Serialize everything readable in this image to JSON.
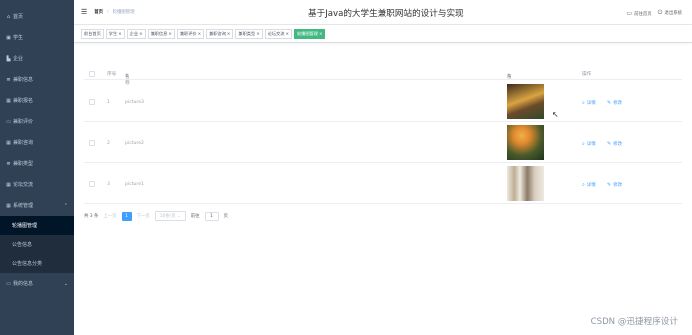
{
  "sidebar": {
    "items": [
      {
        "label": "首页",
        "icon": "home-icon"
      },
      {
        "label": "学生",
        "icon": "user-icon"
      },
      {
        "label": "企业",
        "icon": "building-icon"
      },
      {
        "label": "兼职信息",
        "icon": "list-icon"
      },
      {
        "label": "兼职报名",
        "icon": "grid-icon"
      },
      {
        "label": "兼职评价",
        "icon": "monitor-icon"
      },
      {
        "label": "兼职咨询",
        "icon": "grid-icon"
      },
      {
        "label": "兼职类型",
        "icon": "list-icon"
      },
      {
        "label": "论坛交流",
        "icon": "grid-icon"
      },
      {
        "label": "系统管理",
        "icon": "grid-icon",
        "expanded": true
      }
    ],
    "sub_items": [
      {
        "label": "轮播图管理",
        "active": true
      },
      {
        "label": "公告信息",
        "active": false
      },
      {
        "label": "公告信息分类",
        "active": false
      }
    ],
    "last_item": {
      "label": "我的信息",
      "icon": "monitor-icon"
    }
  },
  "header": {
    "breadcrumb_home": "首页",
    "breadcrumb_current": "轮播图管理",
    "title": "基于Java的大学生兼职网站的设计与实现",
    "backend_label": "前往首页",
    "logout_label": "退出系统"
  },
  "tags": [
    {
      "label": "前台首页",
      "closable": false,
      "active": false
    },
    {
      "label": "学生",
      "closable": true,
      "active": false
    },
    {
      "label": "企业",
      "closable": true,
      "active": false
    },
    {
      "label": "兼职信息",
      "closable": true,
      "active": false
    },
    {
      "label": "兼职评价",
      "closable": true,
      "active": false
    },
    {
      "label": "兼职咨询",
      "closable": true,
      "active": false
    },
    {
      "label": "兼职类型",
      "closable": true,
      "active": false
    },
    {
      "label": "论坛交流",
      "closable": true,
      "active": false
    },
    {
      "label": "轮播图管理",
      "closable": true,
      "active": true
    }
  ],
  "table": {
    "headers": {
      "index": "序号",
      "name": "名称",
      "value": "值",
      "ops": "操作"
    },
    "rows": [
      {
        "index": "1",
        "name": "picture3",
        "thumb_colors": [
          "#3b2a1a",
          "#d9a441",
          "#2f4a2a"
        ]
      },
      {
        "index": "2",
        "name": "picture2",
        "thumb_colors": [
          "#2e4b2e",
          "#e0892e",
          "#1f3320"
        ]
      },
      {
        "index": "3",
        "name": "picture1",
        "thumb_colors": [
          "#d9cfc0",
          "#8a7a66",
          "#efe9df"
        ]
      }
    ],
    "detail_label": "详情",
    "edit_label": "修改"
  },
  "pager": {
    "total": "共 3 条",
    "prev": "上一页",
    "page": "1",
    "next": "下一页",
    "size": "10条/页",
    "goto": "前往",
    "goto_value": "1",
    "page_suffix": "页"
  },
  "watermark": "CSDN @迅捷程序设计",
  "colors": {
    "sidebar_bg": "#304156",
    "active_tag": "#42b983",
    "primary": "#409eff"
  }
}
